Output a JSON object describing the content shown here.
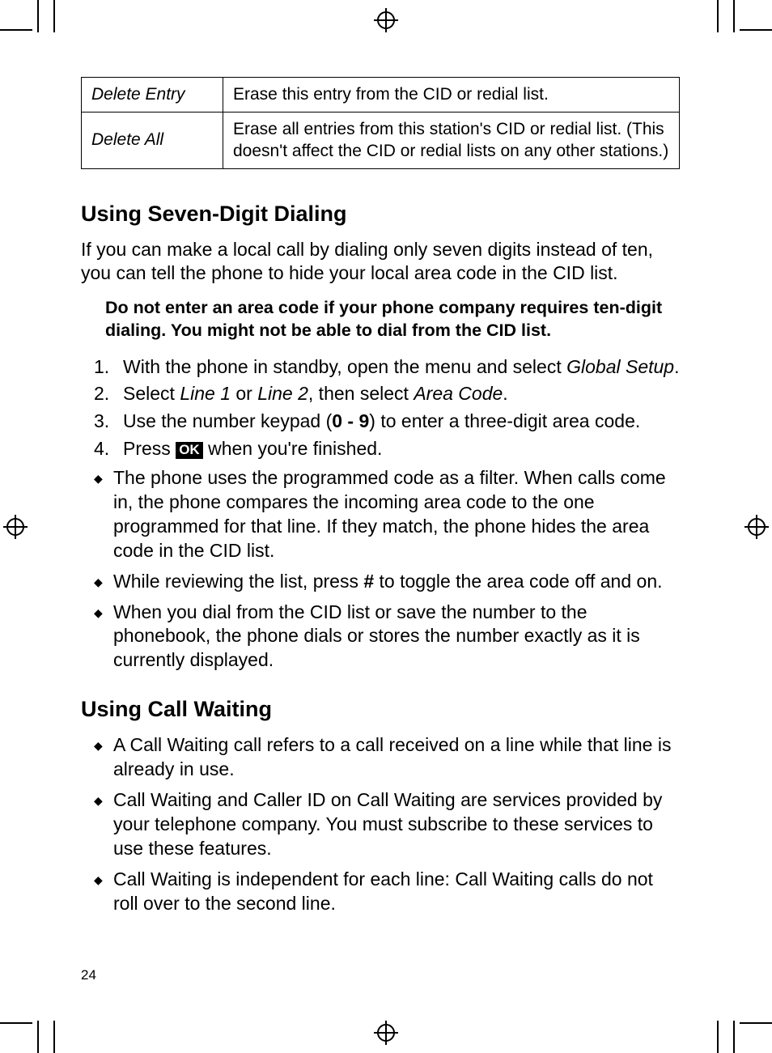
{
  "table": {
    "rows": [
      {
        "label": "Delete Entry",
        "desc": "Erase this entry from the CID or redial list."
      },
      {
        "label": "Delete All",
        "desc": "Erase all entries from this station's CID or redial list. (This doesn't affect the CID or redial lists on any other stations.)"
      }
    ]
  },
  "section1": {
    "heading": "Using Seven-Digit Dialing",
    "intro": "If you can make a local call by dialing only seven digits instead of ten, you can tell the phone to hide your local area code in the CID list.",
    "warning": "Do not enter an area code if your phone company requires ten-digit dialing. You might not be able to dial from the CID list.",
    "steps": {
      "n1": "1.",
      "s1a": "With the phone in standby, open the menu and select ",
      "s1b": "Global Setup",
      "s1c": ".",
      "n2": "2.",
      "s2a": "Select ",
      "s2b": "Line 1",
      "s2c": " or ",
      "s2d": "Line 2",
      "s2e": ", then select ",
      "s2f": "Area Code",
      "s2g": ".",
      "n3": "3.",
      "s3a": "Use the number keypad (",
      "s3b": "0 - 9",
      "s3c": ") to enter a three-digit area code.",
      "n4": "4.",
      "s4a": "Press ",
      "s4b": "OK",
      "s4c": " when you're finished."
    },
    "bullets": [
      "The phone uses the programmed code as a filter. When calls come in, the phone compares the incoming area code to the one programmed for that line. If they match, the phone hides the area code in the CID list."
    ],
    "bullet2a": "While reviewing the list, press ",
    "bullet2b": "#",
    "bullet2c": " to toggle the area code off and on.",
    "bullet3": "When you dial from the CID list or save the number to the phonebook, the phone dials or stores the number exactly as it is currently displayed."
  },
  "section2": {
    "heading": "Using Call Waiting",
    "bullets": [
      "A Call Waiting call refers to a call received on a line while that line is already in use.",
      "Call Waiting and Caller ID on Call Waiting are services provided by your telephone company. You must subscribe to these services to use these features.",
      "Call Waiting is independent for each line: Call Waiting calls do not roll over to the second line."
    ]
  },
  "page_number": "24"
}
